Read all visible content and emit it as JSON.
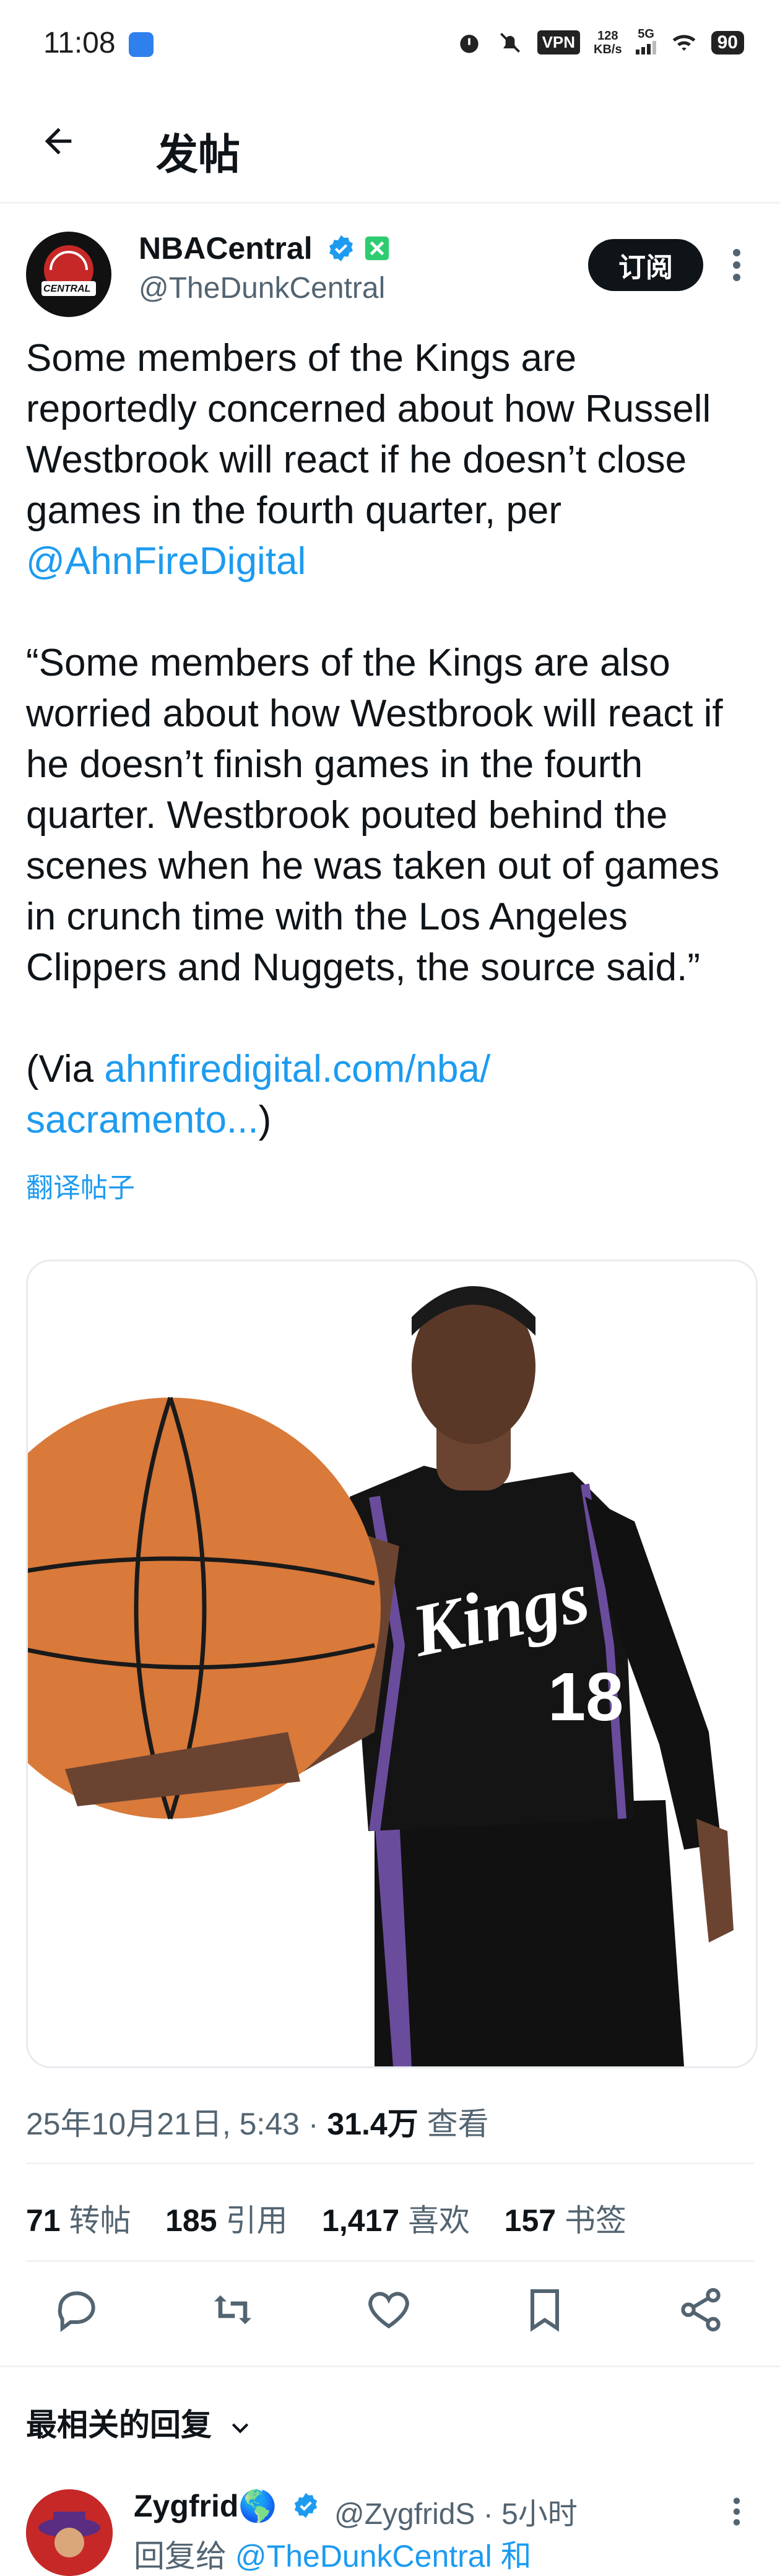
{
  "status_bar": {
    "time": "11:08",
    "vpn": "VPN",
    "speed_value": "128",
    "speed_unit": "KB/s",
    "network": "5G",
    "battery": "90"
  },
  "nav": {
    "title": "发帖"
  },
  "author": {
    "name": "NBACentral",
    "handle": "@TheDunkCentral",
    "avatar_text": "CENTRAL",
    "subscribe_label": "订阅"
  },
  "tweet": {
    "text_part1": "Some members of the Kings are reportedly concerned about how Russell Westbrook will react if he doesn’t close games in the fourth quarter, per ",
    "mention": "@AhnFireDigital",
    "text_part2": "\n\n“Some members of the Kings are also worried about how Westbrook will react if he doesn’t finish games in the fourth quarter. Westbrook pouted behind the scenes when he was taken out of games in crunch time with the Los Angeles Clippers and Nuggets, the source said.”\n\n(Via ",
    "link_text": "ahnfiredigital.com/nba/\nsacramento...",
    "text_part3": ")",
    "translate_label": "翻译帖子"
  },
  "media": {
    "jersey_text": "Kings",
    "jersey_number": "18"
  },
  "meta": {
    "date": "25年10月21日, 5:43",
    "separator": " · ",
    "views_value": "31.4万",
    "views_label": " 查看"
  },
  "stats": {
    "retweets_value": "71",
    "retweets_label": "转帖",
    "quotes_value": "185",
    "quotes_label": "引用",
    "likes_value": "1,417",
    "likes_label": "喜欢",
    "bookmarks_value": "157",
    "bookmarks_label": "书签"
  },
  "replies": {
    "header": "最相关的回复",
    "first": {
      "name": "Zygfrid🌎",
      "handle": "@ZygfridS · 5小时",
      "reply_to_prefix": "回复给 ",
      "reply_to_handle": "@TheDunkCentral 和"
    }
  },
  "colors": {
    "link": "#1d9bf0",
    "verified": "#1d9bf0",
    "secondary_text": "#536471",
    "button_bg": "#0f1419"
  },
  "icons": [
    "back-arrow-icon",
    "verified-icon",
    "grok-icon",
    "more-icon",
    "reply-icon",
    "retweet-icon",
    "like-icon",
    "bookmark-icon",
    "share-icon",
    "chevron-down-icon"
  ]
}
